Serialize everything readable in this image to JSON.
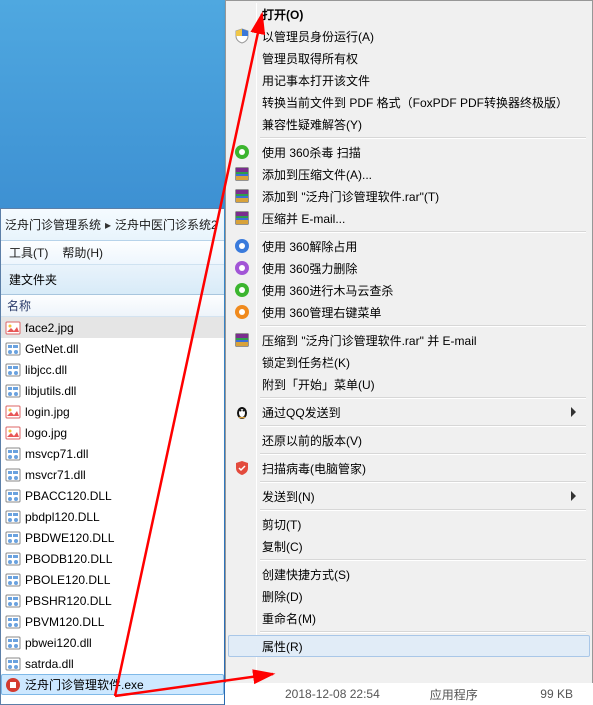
{
  "explorer": {
    "breadcrumbs": {
      "a": "泛舟门诊管理系统",
      "b": "泛舟中医门诊系统2"
    },
    "menu": {
      "tools": "工具(T)",
      "help": "帮助(H)"
    },
    "toolbar": {
      "newfolder": "建文件夹"
    },
    "header": {
      "name": "名称"
    },
    "files": [
      {
        "kind": "img",
        "label": "face2.jpg",
        "cut": true
      },
      {
        "kind": "dll",
        "label": "GetNet.dll"
      },
      {
        "kind": "dll",
        "label": "libjcc.dll"
      },
      {
        "kind": "dll",
        "label": "libjutils.dll"
      },
      {
        "kind": "img",
        "label": "login.jpg"
      },
      {
        "kind": "img",
        "label": "logo.jpg"
      },
      {
        "kind": "dll",
        "label": "msvcp71.dll"
      },
      {
        "kind": "dll",
        "label": "msvcr71.dll"
      },
      {
        "kind": "dll",
        "label": "PBACC120.DLL"
      },
      {
        "kind": "dll",
        "label": "pbdpl120.DLL"
      },
      {
        "kind": "dll",
        "label": "PBDWE120.DLL"
      },
      {
        "kind": "dll",
        "label": "PBODB120.DLL"
      },
      {
        "kind": "dll",
        "label": "PBOLE120.DLL"
      },
      {
        "kind": "dll",
        "label": "PBSHR120.DLL"
      },
      {
        "kind": "dll",
        "label": "PBVM120.DLL"
      },
      {
        "kind": "dll",
        "label": "pbwei120.dll"
      },
      {
        "kind": "dll",
        "label": "satrda.dll"
      },
      {
        "kind": "exe",
        "label": "泛舟门诊管理软件.exe",
        "sel": true
      }
    ]
  },
  "context": {
    "items": [
      {
        "t": "打开(O)",
        "bold": true
      },
      {
        "t": "以管理员身份运行(A)",
        "ico": "shield"
      },
      {
        "t": "管理员取得所有权"
      },
      {
        "t": "用记事本打开该文件"
      },
      {
        "t": "转换当前文件到 PDF 格式（FoxPDF PDF转换器终极版）"
      },
      {
        "t": "兼容性疑难解答(Y)"
      },
      {
        "sep": true
      },
      {
        "t": "使用 360杀毒 扫描",
        "ico": "green"
      },
      {
        "t": "添加到压缩文件(A)...",
        "ico": "rar"
      },
      {
        "t": "添加到 \"泛舟门诊管理软件.rar\"(T)",
        "ico": "rar"
      },
      {
        "t": "压缩并 E-mail...",
        "ico": "rar"
      },
      {
        "sep": true
      },
      {
        "t": "使用 360解除占用",
        "ico": "blue"
      },
      {
        "t": "使用 360强力删除",
        "ico": "purple"
      },
      {
        "t": "使用 360进行木马云查杀",
        "ico": "green"
      },
      {
        "t": "使用 360管理右键菜单",
        "ico": "orange"
      },
      {
        "sep": true
      },
      {
        "t": "压缩到 \"泛舟门诊管理软件.rar\" 并 E-mail",
        "ico": "rar"
      },
      {
        "t": "锁定到任务栏(K)"
      },
      {
        "t": "附到「开始」菜单(U)"
      },
      {
        "sep": true
      },
      {
        "t": "通过QQ发送到",
        "ico": "qq",
        "sub": true
      },
      {
        "sep": true
      },
      {
        "t": "还原以前的版本(V)"
      },
      {
        "sep": true
      },
      {
        "t": "扫描病毒(电脑管家)",
        "ico": "redshield"
      },
      {
        "sep": true
      },
      {
        "t": "发送到(N)",
        "sub": true
      },
      {
        "sep": true
      },
      {
        "t": "剪切(T)"
      },
      {
        "t": "复制(C)"
      },
      {
        "sep": true
      },
      {
        "t": "创建快捷方式(S)"
      },
      {
        "t": "删除(D)"
      },
      {
        "t": "重命名(M)"
      },
      {
        "sep": true
      },
      {
        "t": "属性(R)",
        "hl": true
      }
    ]
  },
  "status": {
    "date": "2018-12-08 22:54",
    "type": "应用程序",
    "size": "99 KB"
  },
  "icons": {
    "shield": "#f0c000",
    "green": "#3cb52f",
    "rar": "#000000",
    "blue": "#3a7bdc",
    "purple": "#a255d6",
    "orange": "#f08a1d",
    "qq": "#111",
    "redshield": "#e34b3d"
  }
}
